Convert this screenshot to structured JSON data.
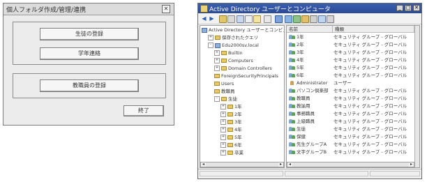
{
  "dialog": {
    "title": "個人フォルダ作成/管理/連携",
    "close_label": "✕",
    "student_button": "生徒の登録",
    "grade_button": "学年連絡",
    "staff_button": "教職員の登録",
    "exit_button": "終了"
  },
  "ad_window": {
    "title": "Active Directory ユーザーとコンピュータ",
    "controls": {
      "minimize": "_",
      "maximize": "□",
      "close": "✕"
    },
    "tree": [
      {
        "label": "Active Directory ユーザーとコンピュー",
        "depth": 0,
        "icon": "ad-root-icon",
        "expander": ""
      },
      {
        "label": "保存されたクエリ",
        "depth": 1,
        "icon": "folder-icon",
        "expander": "+"
      },
      {
        "label": "Edu2000sv.local",
        "depth": 1,
        "icon": "domain-icon",
        "expander": "-"
      },
      {
        "label": "Builtin",
        "depth": 2,
        "icon": "folder-icon",
        "expander": "+"
      },
      {
        "label": "Computers",
        "depth": 2,
        "icon": "folder-icon",
        "expander": "+"
      },
      {
        "label": "Domain Controllers",
        "depth": 2,
        "icon": "folder-icon",
        "expander": "+"
      },
      {
        "label": "ForeignSecurityPrincipals",
        "depth": 2,
        "icon": "folder-icon",
        "expander": ""
      },
      {
        "label": "Users",
        "depth": 2,
        "icon": "folder-icon",
        "expander": ""
      },
      {
        "label": "教職員",
        "depth": 2,
        "icon": "folder-icon",
        "expander": ""
      },
      {
        "label": "生徒",
        "depth": 2,
        "icon": "folder-icon",
        "expander": "-"
      },
      {
        "label": "1年",
        "depth": 3,
        "icon": "folder-icon",
        "expander": "+"
      },
      {
        "label": "2年",
        "depth": 3,
        "icon": "folder-icon",
        "expander": "+"
      },
      {
        "label": "3年",
        "depth": 3,
        "icon": "folder-icon",
        "expander": "+"
      },
      {
        "label": "4年",
        "depth": 3,
        "icon": "folder-icon",
        "expander": "+"
      },
      {
        "label": "5年",
        "depth": 3,
        "icon": "folder-icon",
        "expander": "+"
      },
      {
        "label": "6年",
        "depth": 3,
        "icon": "folder-icon",
        "expander": "+"
      },
      {
        "label": "卒業",
        "depth": 3,
        "icon": "folder-icon",
        "expander": "+"
      }
    ],
    "list_headers": [
      "名前",
      "種類"
    ],
    "list_rows": [
      {
        "name": "1年",
        "type": "セキュリティ グループ - グローバル",
        "icon": "group-icon"
      },
      {
        "name": "2年",
        "type": "セキュリティ グループ - グローバル",
        "icon": "group-icon"
      },
      {
        "name": "3年",
        "type": "セキュリティ グループ - グローバル",
        "icon": "group-icon"
      },
      {
        "name": "4年",
        "type": "セキュリティ グループ - グローバル",
        "icon": "group-icon"
      },
      {
        "name": "5年",
        "type": "セキュリティ グループ - グローバル",
        "icon": "group-icon"
      },
      {
        "name": "6年",
        "type": "セキュリティ グループ - グローバル",
        "icon": "group-icon"
      },
      {
        "name": "Administrator",
        "type": "ユーザー",
        "icon": "user-icon"
      },
      {
        "name": "パソコン倶楽部",
        "type": "セキュリティ グループ - グローバル",
        "icon": "group-icon"
      },
      {
        "name": "教職員",
        "type": "セキュリティ グループ - グローバル",
        "icon": "group-icon"
      },
      {
        "name": "教諭用",
        "type": "セキュリティ グループ - グローバル",
        "icon": "group-icon"
      },
      {
        "name": "事務職員",
        "type": "セキュリティ グループ - グローバル",
        "icon": "group-icon"
      },
      {
        "name": "上級職員",
        "type": "セキュリティ グループ - グローバル",
        "icon": "group-icon"
      },
      {
        "name": "生徒",
        "type": "セキュリティ グループ - グローバル",
        "icon": "group-icon"
      },
      {
        "name": "保健",
        "type": "セキュリティ グループ - グローバル",
        "icon": "group-icon"
      },
      {
        "name": "先生グループA",
        "type": "セキュリティ グループ - グローバル",
        "icon": "group-icon"
      },
      {
        "name": "文字グループB",
        "type": "セキュリティ グループ - グローバル",
        "icon": "group-icon"
      }
    ]
  }
}
